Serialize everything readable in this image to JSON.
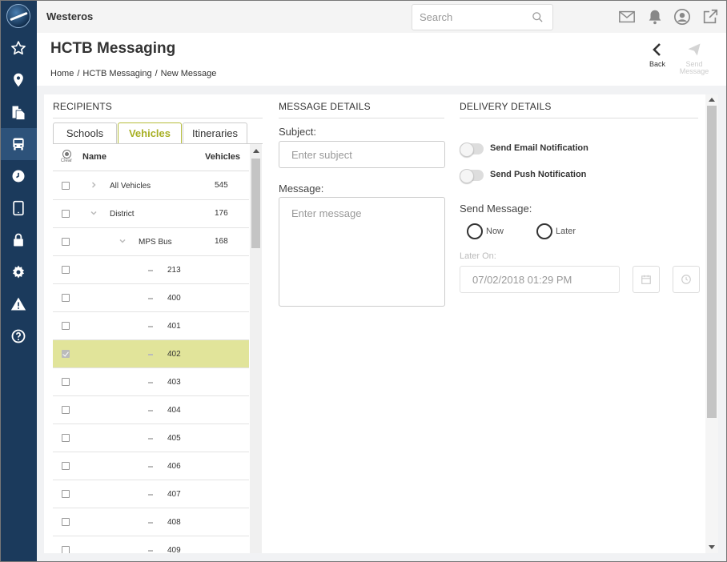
{
  "app": {
    "name": "Westeros"
  },
  "search": {
    "placeholder": "Search"
  },
  "header": {
    "title": "HCTB Messaging",
    "breadcrumb": [
      "Home",
      "HCTB Messaging",
      "New Message"
    ],
    "back_label": "Back",
    "send_label": "Send Message"
  },
  "recipients": {
    "title": "RECIPIENTS",
    "tabs": [
      "Schools",
      "Vehicles",
      "Itineraries"
    ],
    "active_tab": "Vehicles",
    "clear_label": "Clear",
    "columns": {
      "name": "Name",
      "vehicles": "Vehicles"
    },
    "rows": [
      {
        "name": "All Vehicles",
        "count": "545",
        "level": 0,
        "expander": "collapsed",
        "checked": false
      },
      {
        "name": "District",
        "count": "176",
        "level": 0,
        "expander": "expanded",
        "checked": false
      },
      {
        "name": "MPS Bus",
        "count": "168",
        "level": 1,
        "expander": "expanded",
        "checked": false
      },
      {
        "name": "213",
        "count": "",
        "level": 2,
        "expander": "leaf",
        "checked": false
      },
      {
        "name": "400",
        "count": "",
        "level": 2,
        "expander": "leaf",
        "checked": false
      },
      {
        "name": "401",
        "count": "",
        "level": 2,
        "expander": "leaf",
        "checked": false
      },
      {
        "name": "402",
        "count": "",
        "level": 2,
        "expander": "leaf",
        "checked": true
      },
      {
        "name": "403",
        "count": "",
        "level": 2,
        "expander": "leaf",
        "checked": false
      },
      {
        "name": "404",
        "count": "",
        "level": 2,
        "expander": "leaf",
        "checked": false
      },
      {
        "name": "405",
        "count": "",
        "level": 2,
        "expander": "leaf",
        "checked": false
      },
      {
        "name": "406",
        "count": "",
        "level": 2,
        "expander": "leaf",
        "checked": false
      },
      {
        "name": "407",
        "count": "",
        "level": 2,
        "expander": "leaf",
        "checked": false
      },
      {
        "name": "408",
        "count": "",
        "level": 2,
        "expander": "leaf",
        "checked": false
      },
      {
        "name": "409",
        "count": "",
        "level": 2,
        "expander": "leaf",
        "checked": false
      }
    ]
  },
  "message": {
    "title": "MESSAGE DETAILS",
    "subject_label": "Subject:",
    "subject_placeholder": "Enter subject",
    "message_label": "Message:",
    "message_placeholder": "Enter message"
  },
  "delivery": {
    "title": "DELIVERY DETAILS",
    "email_label": "Send Email Notification",
    "push_label": "Send Push Notification",
    "send_message_label": "Send Message:",
    "now_label": "Now",
    "later_label": "Later",
    "later_on_label": "Later On:",
    "datetime_placeholder": "07/02/2018 01:29 PM"
  },
  "sidebar": {
    "items": [
      "star-icon",
      "location-pin-icon",
      "documents-icon",
      "bus-icon",
      "clock-icon",
      "tablet-icon",
      "lock-icon",
      "gear-icon",
      "warning-icon",
      "help-icon"
    ],
    "active": "bus-icon"
  },
  "colors": {
    "sidebar": "#1b3a5c",
    "sidebar_active": "#2d527a",
    "accent": "#a8b025",
    "selected_row": "#e1e49a"
  }
}
